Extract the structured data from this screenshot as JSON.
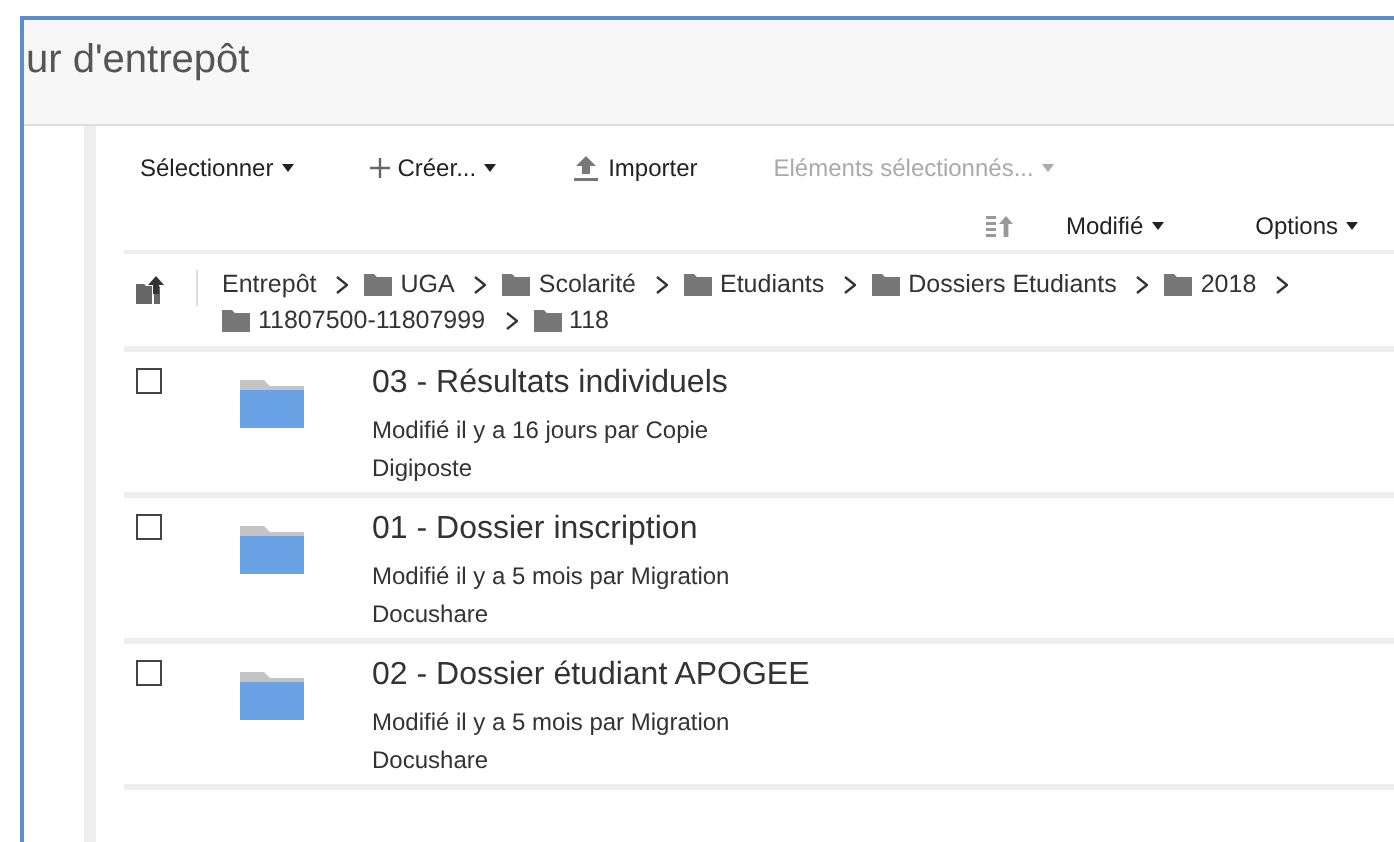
{
  "header": {
    "title": "ur d'entrepôt"
  },
  "toolbar": {
    "actions": [
      {
        "label": "Sélectionner",
        "kind": "menu",
        "disabled": false
      },
      {
        "label": "Créer...",
        "kind": "create",
        "disabled": false
      },
      {
        "label": "Importer",
        "kind": "upload",
        "disabled": false
      },
      {
        "label": "Eléments sélectionnés...",
        "kind": "menu",
        "disabled": true
      }
    ],
    "sort": {
      "label": "Modifié"
    },
    "options": {
      "label": "Options"
    }
  },
  "breadcrumb": [
    {
      "label": "Entrepôt",
      "kind": "root"
    },
    {
      "label": "UGA",
      "kind": "folder"
    },
    {
      "label": "Scolarité",
      "kind": "folder"
    },
    {
      "label": "Etudiants",
      "kind": "folder"
    },
    {
      "label": "Dossiers Etudiants",
      "kind": "folder"
    },
    {
      "label": "2018",
      "kind": "folder"
    },
    {
      "label": "11807500-11807999",
      "kind": "folder"
    },
    {
      "label": "118",
      "kind": "folder"
    }
  ],
  "items": [
    {
      "name": "03 - Résultats individuels",
      "meta": "Modifié il y a 16 jours par Copie Digiposte",
      "checked": false
    },
    {
      "name": "01 - Dossier inscription",
      "meta": "Modifié il y a 5 mois par Migration Docushare",
      "checked": false
    },
    {
      "name": "02 - Dossier étudiant APOGEE",
      "meta": "Modifié il y a 5 mois par Migration Docushare",
      "checked": false
    }
  ]
}
